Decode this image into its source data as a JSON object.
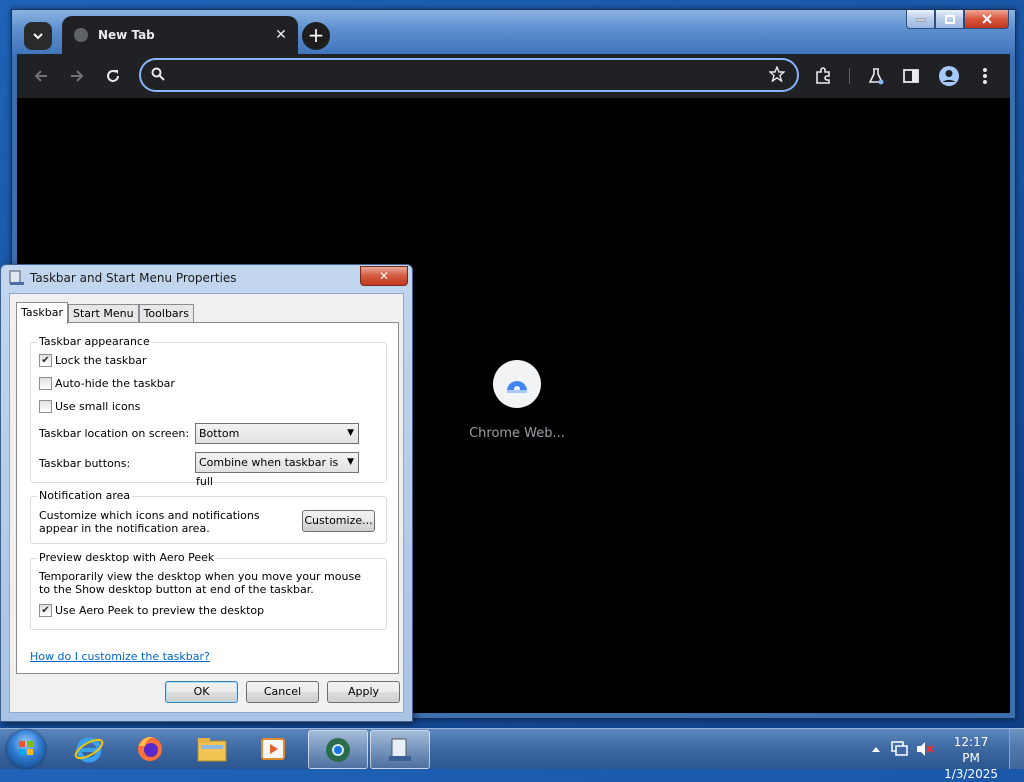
{
  "browser": {
    "tab": {
      "title": "New Tab",
      "close_glyph": "✕"
    },
    "newtab_glyph": "+",
    "omnibox": {
      "value": "",
      "placeholder": ""
    },
    "shortcut": {
      "label": "Chrome Web..."
    }
  },
  "dialog": {
    "title": "Taskbar and Start Menu Properties",
    "close_glyph": "✕",
    "tabs": [
      "Taskbar",
      "Start Menu",
      "Toolbars"
    ],
    "appearance": {
      "title": "Taskbar appearance",
      "lock_label": "Lock the taskbar",
      "lock_checked": true,
      "autohide_label": "Auto-hide the taskbar",
      "autohide_checked": false,
      "small_icons_label": "Use small icons",
      "small_icons_checked": false,
      "location_label": "Taskbar location on screen:",
      "location_value": "Bottom",
      "buttons_label": "Taskbar buttons:",
      "buttons_value": "Combine when taskbar is full"
    },
    "notification": {
      "title": "Notification area",
      "text": "Customize which icons and notifications appear in the notification area.",
      "customize_button": "Customize..."
    },
    "aero_peek": {
      "title": "Preview desktop with Aero Peek",
      "text": "Temporarily view the desktop when you move your mouse to the Show desktop button at end of the taskbar.",
      "use_label": "Use Aero Peek to preview the desktop",
      "use_checked": true
    },
    "help_link": "How do I customize the taskbar?",
    "buttons": {
      "ok": "OK",
      "cancel": "Cancel",
      "apply": "Apply"
    }
  },
  "taskbar": {
    "time": "12:17 PM",
    "date": "1/3/2025",
    "apps": [
      "internet-explorer",
      "firefox",
      "file-explorer",
      "media-player",
      "chrome",
      "taskbar-properties"
    ]
  },
  "colors": {
    "accent": "#8ab4f8",
    "chrome_bg": "#202124",
    "link": "#0066cc"
  }
}
